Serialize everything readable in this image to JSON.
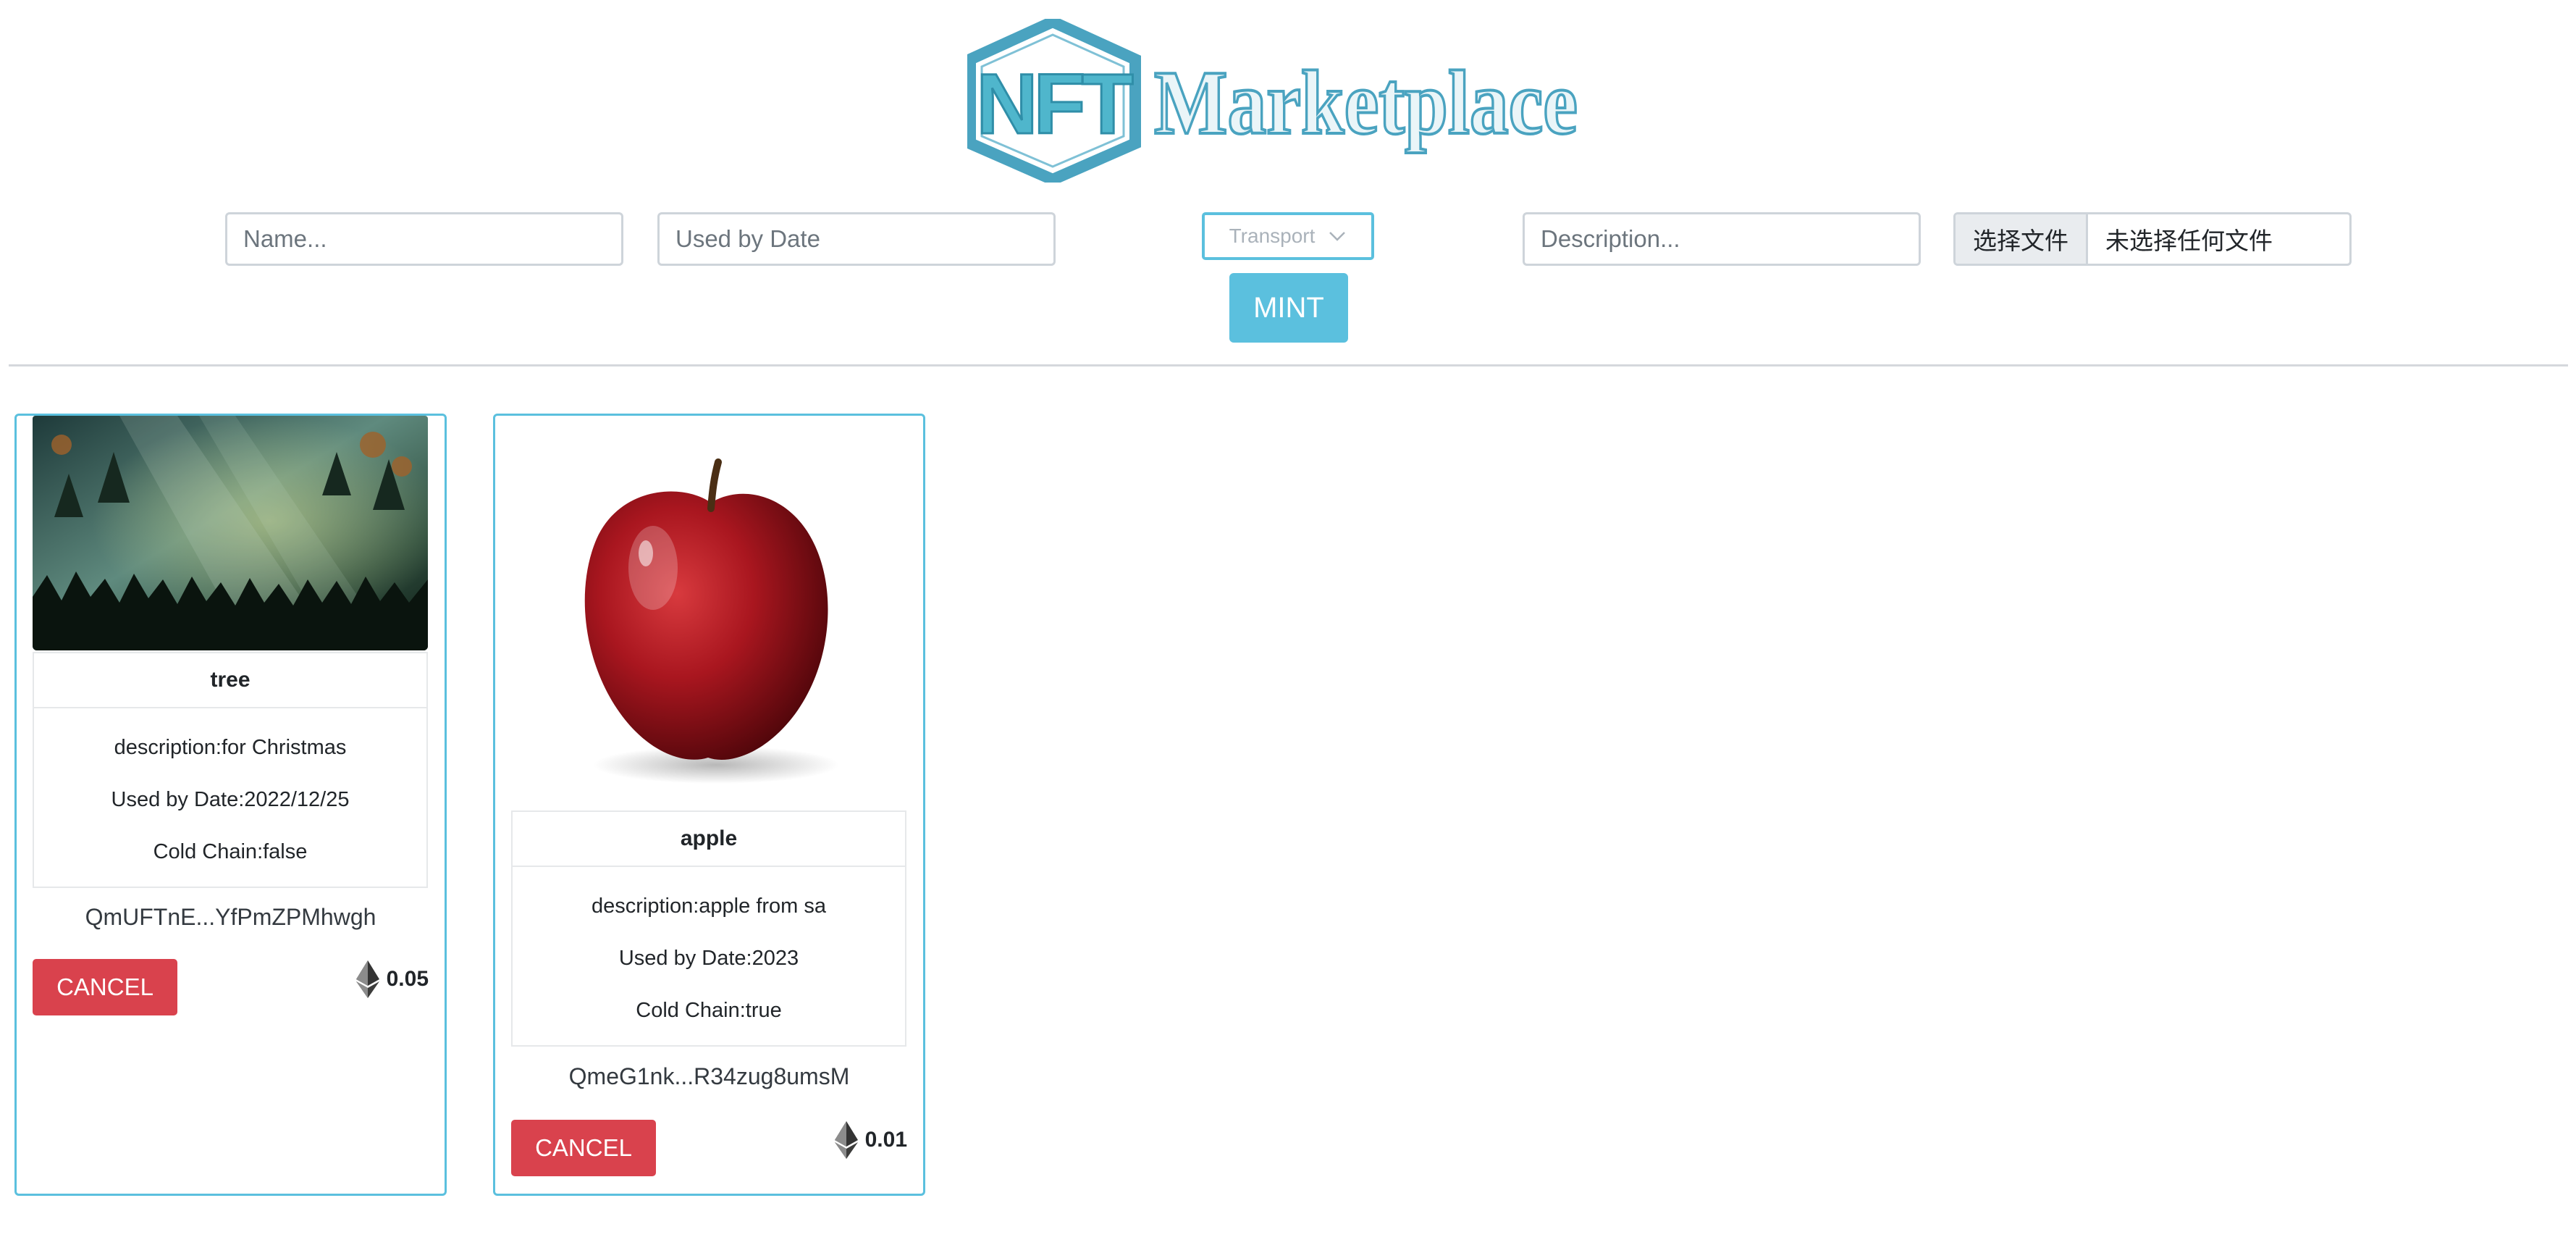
{
  "logo": {
    "mark_letters": "NFT",
    "wordmark": "Marketplace"
  },
  "form": {
    "name_placeholder": "Name...",
    "date_placeholder": "Used by Date",
    "transport_value": "Transport",
    "description_placeholder": "Description...",
    "file_button_label": "选择文件",
    "file_status": "未选择任何文件",
    "mint_label": "MINT"
  },
  "cards": [
    {
      "title": "tree",
      "description": "description:for Christmas",
      "used_by": "Used by Date:2022/12/25",
      "cold_chain": "Cold Chain:false",
      "hash": "QmUFTnE...YfPmZPMhwgh",
      "cancel_label": "CANCEL",
      "price": "0.05",
      "image": "misty-forest-image"
    },
    {
      "title": "apple",
      "description": "description:apple from sa",
      "used_by": "Used by Date:2023",
      "cold_chain": "Cold Chain:true",
      "hash": "QmeG1nk...R34zug8umsM",
      "cancel_label": "CANCEL",
      "price": "0.01",
      "image": "red-apple-image"
    }
  ],
  "colors": {
    "accent": "#5bc0de",
    "danger": "#d9424d",
    "logo": "#4aa3c0"
  },
  "icons": {
    "price_currency": "ethereum-icon",
    "dropdown": "chevron-down-icon"
  }
}
